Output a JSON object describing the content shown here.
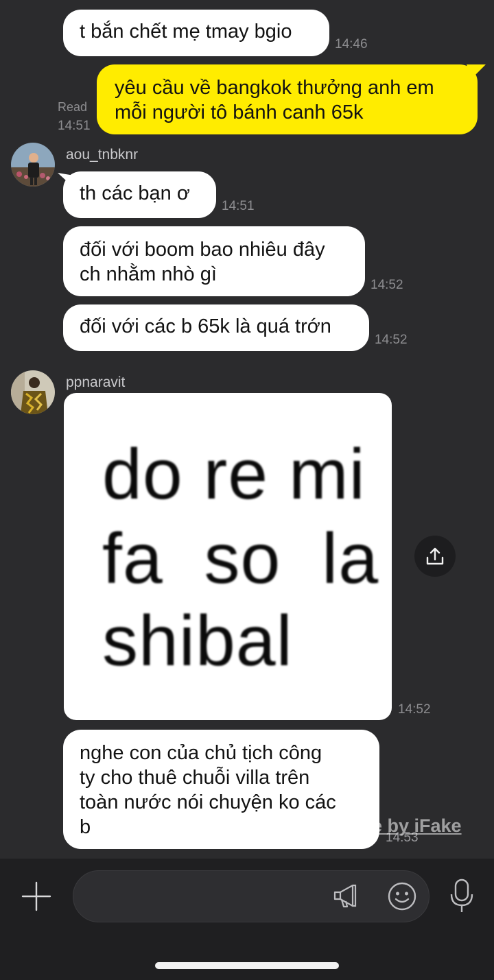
{
  "messages": [
    {
      "text": "t bắn chết mẹ tmay bgio",
      "time": "14:46"
    },
    {
      "text": "yêu cầu về bangkok thưởng anh em\nmỗi người tô bánh canh 65k",
      "time": "14:51",
      "read": "Read"
    },
    {
      "sender": "aou_tnbknr",
      "text": "th các bạn ơ",
      "time": "14:51"
    },
    {
      "text": "đối với boom bao nhiêu đây\nch nhằm nhò gì",
      "time": "14:52"
    },
    {
      "text": "đối với các b 65k là quá trớn",
      "time": "14:52"
    },
    {
      "sender": "ppnaravit",
      "image_lines": [
        "do re mi",
        "fa  so  la",
        "shibal"
      ],
      "time": "14:52"
    },
    {
      "text": "nghe con của chủ tịch công\nty cho thuê chuỗi villa trên\ntoàn nước nói chuyện ko các\nb",
      "time": "14:53"
    }
  ],
  "watermark": "Made by iFake",
  "icons": {
    "share": "share-upload-icon",
    "add": "plus-icon",
    "announce": "megaphone-icon",
    "emoji": "emoji-icon",
    "voice": "microphone-icon"
  },
  "colors": {
    "background": "#2b2b2d",
    "my_bubble": "#ffec00",
    "their_bubble": "#ffffff",
    "input_bar": "#1f1f21"
  }
}
